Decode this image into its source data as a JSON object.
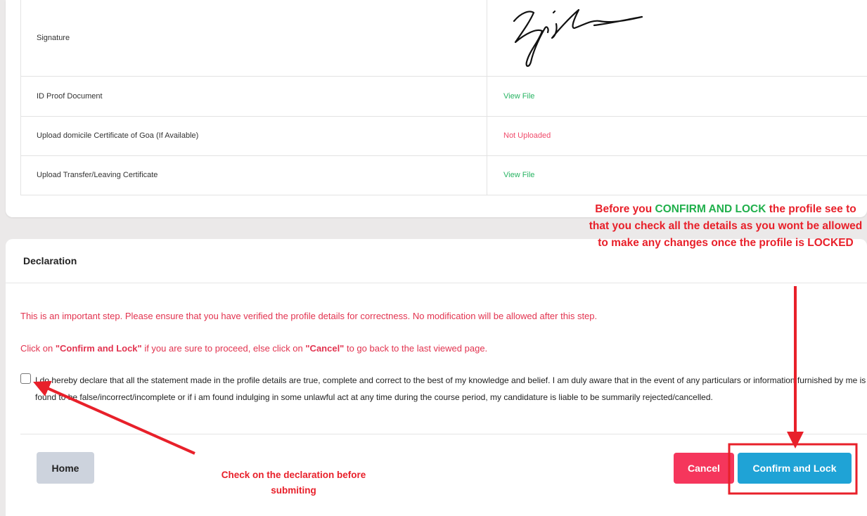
{
  "documents": {
    "rows": [
      {
        "label": "Signature",
        "value": ""
      },
      {
        "label": "ID Proof Document",
        "value": "View File"
      },
      {
        "label": "Upload domicile Certificate of Goa (If Available)",
        "value": "Not Uploaded"
      },
      {
        "label": "Upload Transfer/Leaving Certificate",
        "value": "View File"
      }
    ]
  },
  "declaration": {
    "title": "Declaration",
    "warning_line1": "This is an important step. Please ensure that you have verified the profile details for correctness. No modification will be allowed after this step.",
    "warning_line2": {
      "pre": "Click on ",
      "confirm": "\"Confirm and Lock\"",
      "mid": " if you are sure to proceed, else click on ",
      "cancel": "\"Cancel\"",
      "post": " to go back to the last viewed page."
    },
    "checkbox_text": "I do hereby declare that all the statement made in the profile details are true, complete and correct to the best of my knowledge and belief. I am duly aware that in the event of any particulars or information furnished by me is found to be false/incorrect/incomplete or if i am found indulging in some unlawful act at any time during the course period, my candidature is liable to be summarily rejected/cancelled.",
    "checkbox_checked": false
  },
  "buttons": {
    "home": "Home",
    "cancel": "Cancel",
    "confirm": "Confirm and Lock"
  },
  "annotations": {
    "top_note": {
      "pre": "Before you ",
      "highlight": "CONFIRM AND LOCK",
      "post": " the profile see to that you check all the details as you wont be allowed to make any changes once the profile is LOCKED"
    },
    "bottom_note": "Check on the declaration before submiting"
  },
  "colors": {
    "link_ok": "#28b463",
    "link_bad": "#f04a6a",
    "warning_text": "#e2334f",
    "annotation_red": "#e8202a",
    "annotation_green": "#21b04c",
    "cancel_button": "#f5365c",
    "confirm_button": "#1fa3d6",
    "home_button": "#cdd3dd"
  }
}
